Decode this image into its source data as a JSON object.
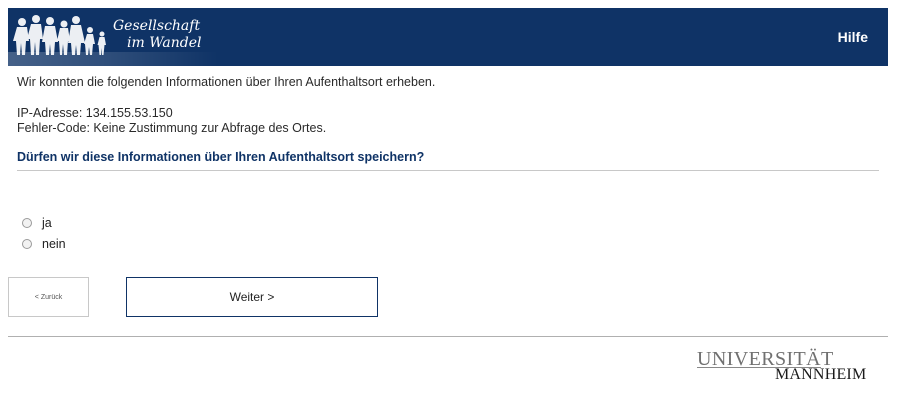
{
  "header": {
    "logo_line1": "Gesellschaft",
    "logo_line2": "im Wandel",
    "help_label": "Hilfe",
    "bg_color": "#0f3366"
  },
  "body": {
    "intro": "Wir konnten die folgenden Informationen über Ihren Aufenthaltsort erheben.",
    "ip_line": "IP-Adresse: 134.155.53.150",
    "error_line": "Fehler-Code: Keine Zustimmung zur Abfrage des Ortes.",
    "question": "Dürfen wir diese Informationen über Ihren Aufenthaltsort speichern?"
  },
  "options": [
    {
      "label": "ja",
      "selected": false
    },
    {
      "label": "nein",
      "selected": false
    }
  ],
  "buttons": {
    "back_label": "< Zurück",
    "next_label": "Weiter >"
  },
  "footer": {
    "logo_top": "UNIVERSITÄT",
    "logo_bottom": "MANNHEIM"
  }
}
